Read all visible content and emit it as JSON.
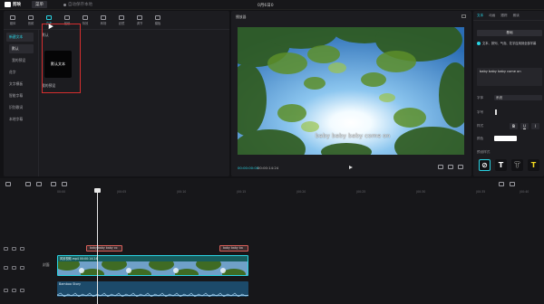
{
  "titlebar": {
    "app_name": "剪映",
    "menu_label": "菜单",
    "draft_status": "自动保存本地",
    "project_title": "0月6日0"
  },
  "toolbar": [
    {
      "label": "媒体",
      "icon": "media-icon"
    },
    {
      "label": "音频",
      "icon": "audio-icon"
    },
    {
      "label": "文本",
      "icon": "text-icon",
      "active": true
    },
    {
      "label": "贴纸",
      "icon": "sticker-icon"
    },
    {
      "label": "特效",
      "icon": "effects-icon"
    },
    {
      "label": "转场",
      "icon": "transition-icon"
    },
    {
      "label": "滤镜",
      "icon": "filter-icon"
    },
    {
      "label": "调节",
      "icon": "adjust-icon"
    },
    {
      "label": "模板",
      "icon": "template-icon"
    }
  ],
  "sidebar": {
    "items": [
      {
        "label": "新建文本",
        "active": true
      },
      {
        "label": "默认",
        "sub": true,
        "selected": true
      },
      {
        "label": "我的预设",
        "sub": true
      },
      {
        "label": "花字"
      },
      {
        "label": "文字模板"
      },
      {
        "label": "智能字幕"
      },
      {
        "label": "识别歌词"
      },
      {
        "label": "本地字幕"
      }
    ]
  },
  "content": {
    "section_default": "默认",
    "default_card": "默认文本",
    "section_presets": "我的预设"
  },
  "player": {
    "title": "播放器",
    "subtitle": "baby baby baby come on",
    "current_time": "00:00:00:00",
    "total_time": "00:00:14:24"
  },
  "inspector": {
    "tabs": [
      "文本",
      "动画",
      "跟踪",
      "朗读"
    ],
    "preset_button": "基础",
    "apply_all": "文本、排列、气泡、花字应用到全部字幕",
    "text_value": "baby baby baby come on",
    "font_label": "字体",
    "font_value": "系统",
    "size_label": "字号",
    "style_label": "样式",
    "style_buttons": [
      "B",
      "U",
      "I"
    ],
    "color_label": "颜色",
    "text_color": "#ffffff",
    "preset_style_label": "预设样式",
    "preset_styles": [
      "⊘",
      "T",
      "T",
      "T"
    ]
  },
  "timeline": {
    "ruler": [
      "00:00",
      "|00:05",
      "|00:10",
      "|00:15",
      "|00:20",
      "|00:25",
      "|00:30",
      "|00:35",
      "|00:40"
    ],
    "subtitle_clips": [
      "baby baby baby co",
      "baby baby ba"
    ],
    "video_clip": "风景视频.mp4  00:00:14:24",
    "audio_clip": "Bamboo Story",
    "cover_label": "封面"
  },
  "colors": {
    "accent": "#2ad4e4",
    "highlight": "#d62f2f",
    "subtitle_border": "#d9605a"
  }
}
